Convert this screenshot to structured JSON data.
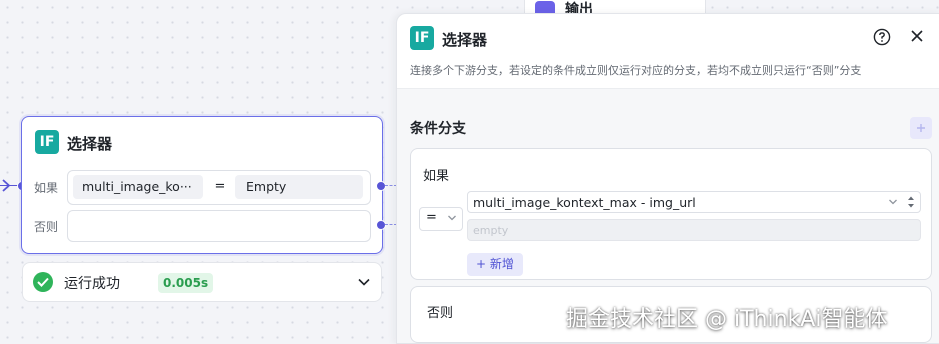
{
  "top_node": {
    "label": "输出"
  },
  "node": {
    "icon_text": "IF",
    "title": "选择器",
    "if_label": "如果",
    "else_label": "否则",
    "condition": {
      "variable": "multi_image_ko···",
      "operator": "=",
      "value": "Empty"
    }
  },
  "run_status": {
    "label": "运行成功",
    "time": "0.005s"
  },
  "panel": {
    "icon_text": "IF",
    "title": "选择器",
    "description": "连接多个下游分支，若设定的条件成立则仅运行对应的分支，若均不成立则只运行“否则”分支",
    "section_title": "条件分支",
    "if_card": {
      "label": "如果",
      "operator": "=",
      "variable": "multi_image_kontext_max - img_url",
      "value_placeholder": "empty",
      "add_label": "+ 新增"
    },
    "else_card": {
      "label": "否则"
    }
  },
  "watermark": "掘金技术社区 @ iThinkAi智能体",
  "colors": {
    "accent": "#5855d6",
    "if_icon": "#17a9a0",
    "success": "#2fb45a"
  }
}
